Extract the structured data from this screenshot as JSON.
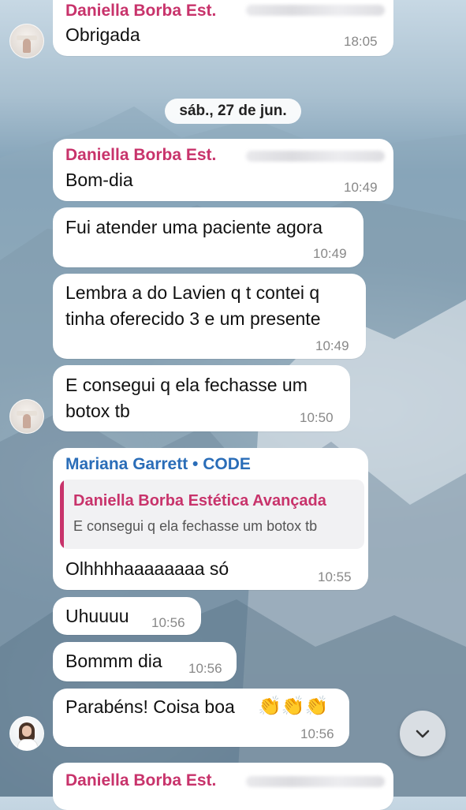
{
  "date_separator": "sáb., 27 de jun.",
  "messages": [
    {
      "sender": "Daniella Borba Est.",
      "text": "Obrigada",
      "time": "18:05"
    },
    {
      "sender": "Daniella Borba Est.",
      "text": "Bom-dia",
      "time": "10:49"
    },
    {
      "text": "Fui atender uma paciente agora",
      "time": "10:49"
    },
    {
      "lines": [
        "Lembra a do Lavien q t contei q",
        "tinha oferecido 3 e um presente"
      ],
      "time": "10:49"
    },
    {
      "lines": [
        "E consegui q ela fechasse um",
        "botox tb"
      ],
      "time": "10:50"
    },
    {
      "sender": "Mariana Garrett • CODE",
      "quote": {
        "name": "Daniella Borba Estética Avançada",
        "text": "E consegui q ela fechasse um botox tb"
      },
      "text": "Olhhhhaaaaaaaa só",
      "time": "10:55"
    },
    {
      "text": "Uhuuuu",
      "time": "10:56"
    },
    {
      "text": "Bommm dia",
      "time": "10:56"
    },
    {
      "text": "Parabéns! Coisa boa",
      "emoji": "👏👏👏",
      "time": "10:56"
    },
    {
      "sender": "Daniella Borba Est."
    }
  ],
  "colors": {
    "sender_pink": "#c8336b",
    "sender_blue": "#2a6db8"
  },
  "icons": {
    "scroll_down": "chevron-down-icon"
  }
}
